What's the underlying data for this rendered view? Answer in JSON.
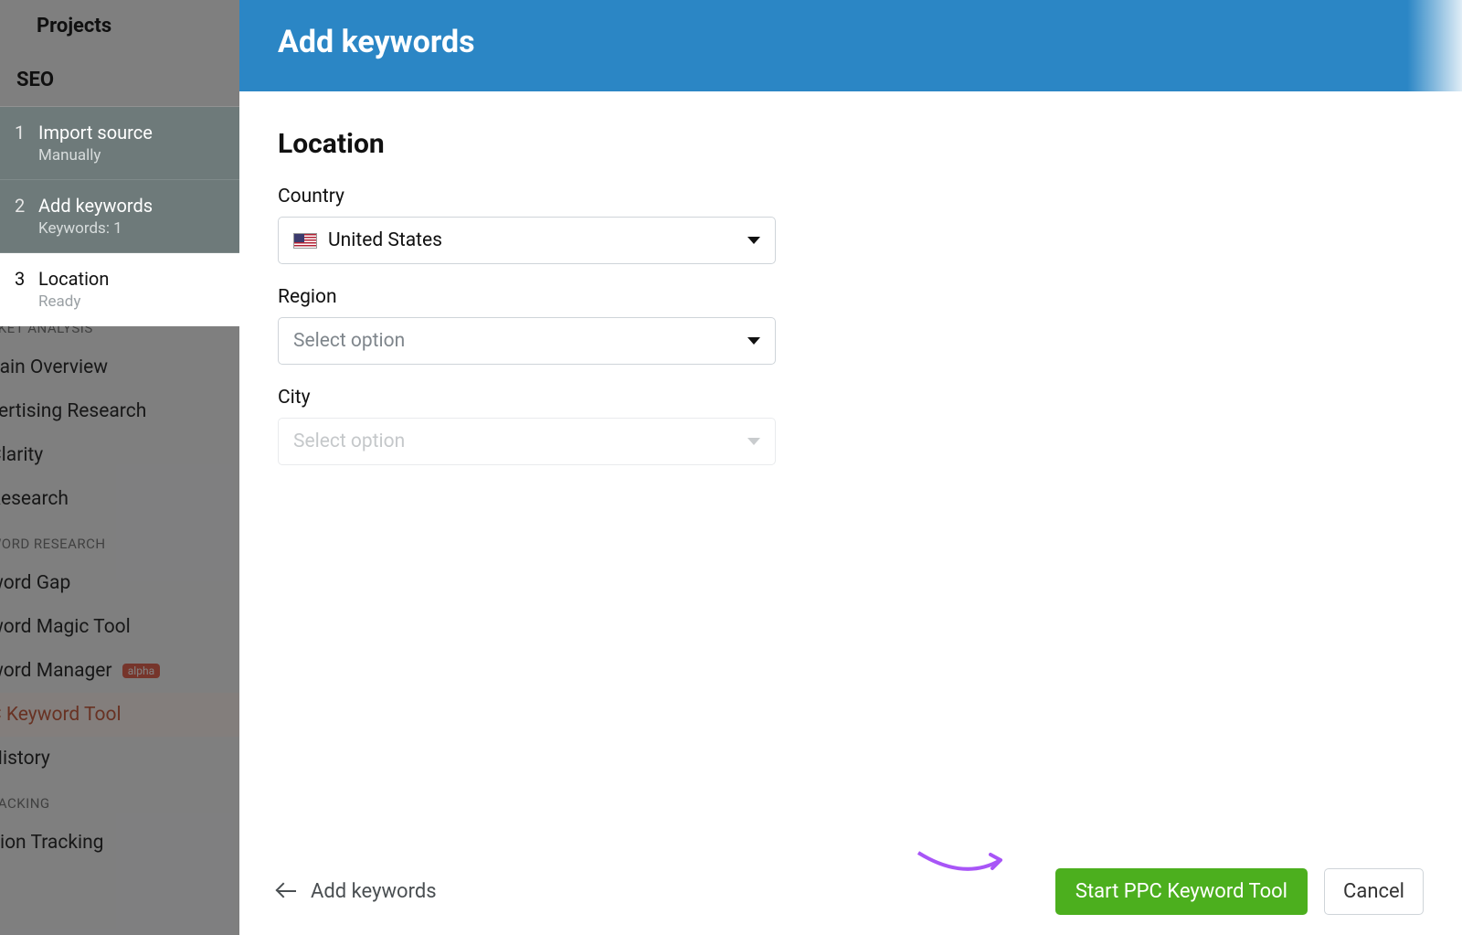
{
  "bg_sidebar": {
    "projects": "Projects",
    "seo": "SEO",
    "section_market": "RKET ANALYSIS",
    "links_market": [
      "nain Overview",
      "vertising Research",
      "Clarity",
      " Research"
    ],
    "section_keyword": "WORD RESEARCH",
    "links_keyword": [
      "word Gap",
      "word Magic Tool",
      "word Manager",
      "C Keyword Tool",
      " History"
    ],
    "alpha_badge": "alpha",
    "section_tracking": "RACKING",
    "link_tracking": "ition Tracking"
  },
  "steps": [
    {
      "num": "1",
      "title": "Import source",
      "sub": "Manually"
    },
    {
      "num": "2",
      "title": "Add keywords",
      "sub": "Keywords: 1"
    },
    {
      "num": "3",
      "title": "Location",
      "sub": "Ready"
    }
  ],
  "modal": {
    "header": "Add keywords",
    "section_title": "Location",
    "country_label": "Country",
    "country_value": "United States",
    "region_label": "Region",
    "region_placeholder": "Select option",
    "city_label": "City",
    "city_placeholder": "Select option",
    "back_label": "Add keywords",
    "primary_button": "Start PPC Keyword Tool",
    "cancel_button": "Cancel"
  }
}
